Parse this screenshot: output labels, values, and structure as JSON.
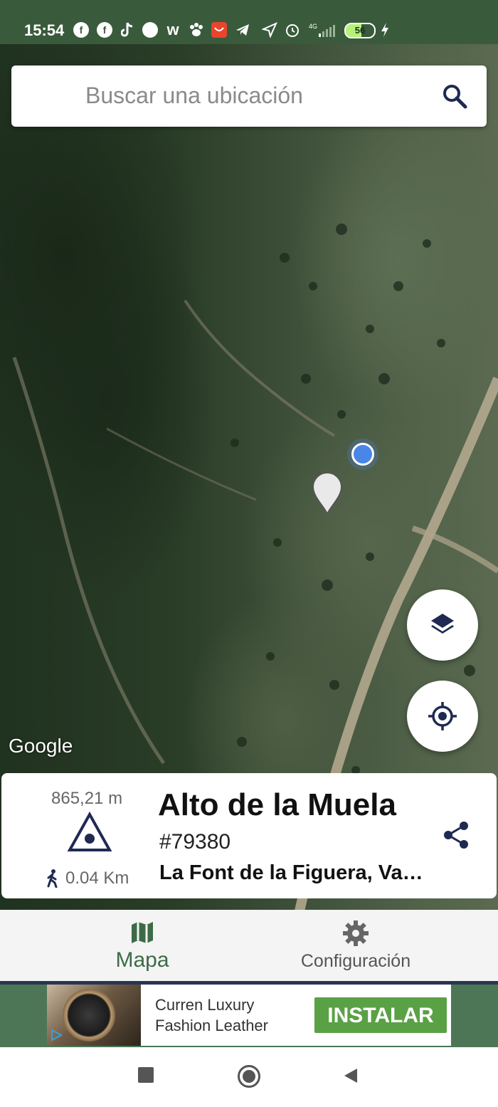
{
  "status_bar": {
    "time": "15:54",
    "battery_level": "56",
    "icons": [
      "facebook-icon",
      "facebook-icon",
      "tiktok-icon",
      "app-icon",
      "w-icon",
      "paw-icon",
      "aliexpress-icon",
      "telegram-icon",
      "navigation-icon",
      "alarm-icon",
      "signal-4g-icon",
      "charging-icon"
    ]
  },
  "search": {
    "placeholder": "Buscar una ubicación",
    "icon": "search-icon"
  },
  "map": {
    "attribution": "Google",
    "layers_icon": "layers-icon",
    "locate_icon": "my-location-icon"
  },
  "card": {
    "elevation": "865,21 m",
    "distance": "0.04 Km",
    "name": "Alto de la Muela",
    "id": "#79380",
    "location": "La Font de la Figuera, Valencia",
    "share_icon": "share-icon"
  },
  "nav": {
    "map_label": "Mapa",
    "settings_label": "Configuración"
  },
  "ad": {
    "line1": "Curren Luxury",
    "line2": "Fashion Leather",
    "install": "INSTALAR"
  },
  "colors": {
    "accent": "#3d6b48",
    "header": "#3a5a3c",
    "install": "#5aa146"
  }
}
